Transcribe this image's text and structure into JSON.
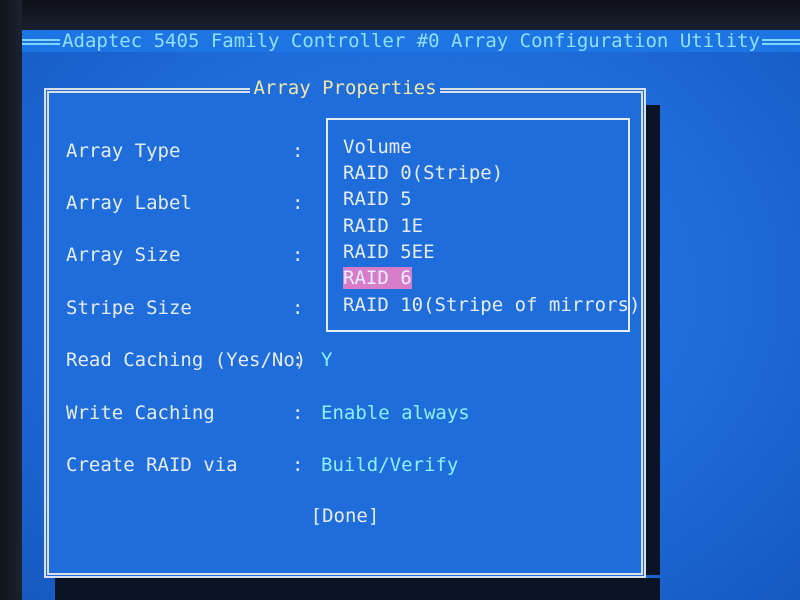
{
  "header": {
    "title": "Adaptec 5405 Family Controller #0 Array Configuration Utility"
  },
  "dialog": {
    "title": "Array Properties",
    "fields": [
      {
        "label": "Array Type",
        "colon": ":",
        "value": ""
      },
      {
        "label": "Array Label",
        "colon": ":",
        "value": ""
      },
      {
        "label": "Array Size",
        "colon": ":",
        "value": ""
      },
      {
        "label": "Stripe Size",
        "colon": ":",
        "value": ""
      },
      {
        "label": "Read Caching (Yes/No)",
        "colon": ":",
        "value": "Y"
      },
      {
        "label": "Write Caching",
        "colon": ":",
        "value": "Enable always"
      },
      {
        "label": "Create RAID via",
        "colon": ":",
        "value": "Build/Verify"
      }
    ],
    "array_type_options": [
      "Volume",
      "RAID 0(Stripe)",
      "RAID 5",
      "RAID 1E",
      "RAID 5EE",
      "RAID 6",
      "RAID 10(Stripe of mirrors)"
    ],
    "selected_option": "RAID 6",
    "done_label": "[Done]"
  },
  "colors": {
    "screen": "#1d6fdc",
    "title_text": "#8fe0ff",
    "dialog_title": "#f0e6a8",
    "value_text": "#8ff0ff",
    "highlight": "#d77cc9"
  }
}
